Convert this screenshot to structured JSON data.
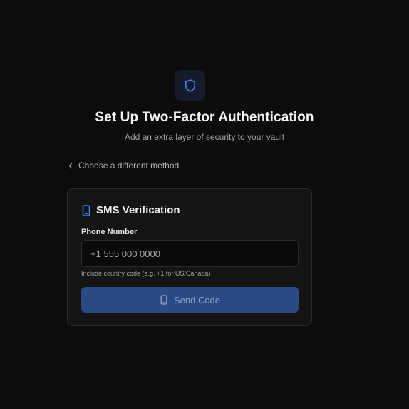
{
  "header": {
    "title": "Set Up Two-Factor Authentication",
    "subtitle": "Add an extra layer of security to your vault",
    "icon": "shield-icon"
  },
  "navigation": {
    "back_label": "Choose a different method"
  },
  "sms_card": {
    "title": "SMS Verification",
    "phone_label": "Phone Number",
    "phone_value": "",
    "phone_placeholder": "+1 555 000 0000",
    "hint": "Include country code (e.g. +1 for US/Canada)",
    "send_button_label": "Send Code",
    "send_button_state": "disabled"
  },
  "colors": {
    "background": "#0c0c0d",
    "card": "#141415",
    "accent": "#3b82f6",
    "button": "#2a4a85"
  }
}
